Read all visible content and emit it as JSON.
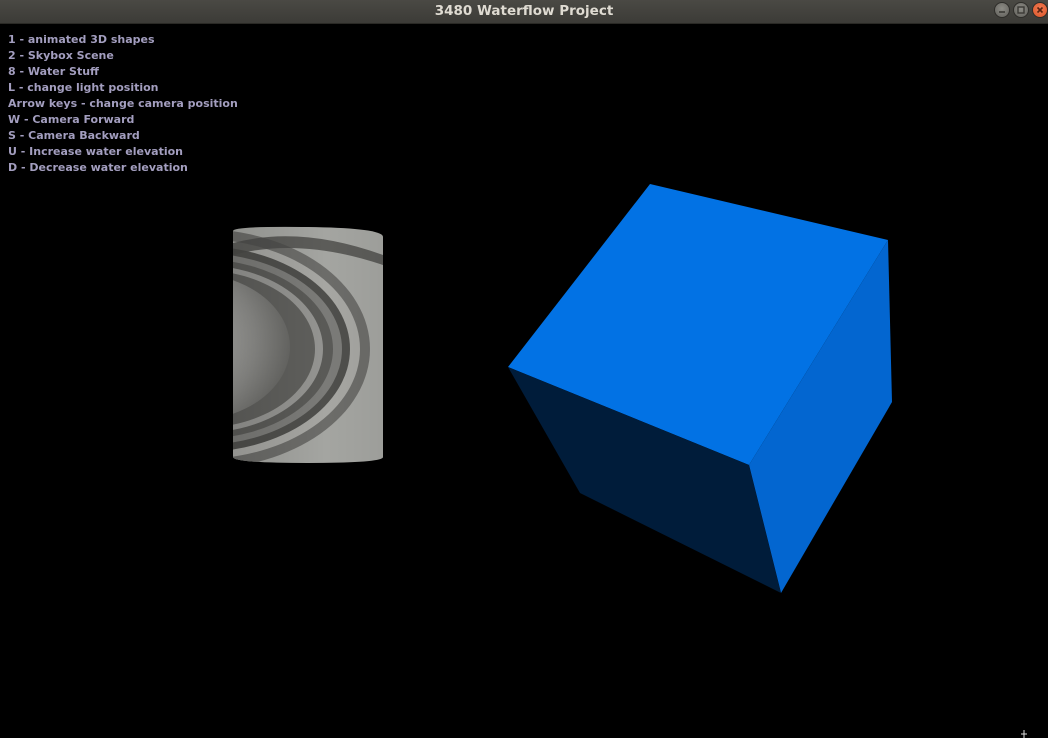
{
  "window": {
    "title": "3480 Waterflow Project"
  },
  "help": {
    "lines": [
      "1 - animated 3D shapes",
      "2 - Skybox Scene",
      "8 - Water Stuff",
      "L - change light position",
      "Arrow keys - change camera position",
      "W - Camera Forward",
      "S - Camera Backward",
      "U - Increase water elevation",
      "D - Decrease water elevation"
    ]
  },
  "scene": {
    "objects": [
      "textured-cylinder",
      "blue-cube"
    ],
    "cube_colors": {
      "top": "#0272e4",
      "right": "#0366d0",
      "left": "#001c3a"
    }
  }
}
